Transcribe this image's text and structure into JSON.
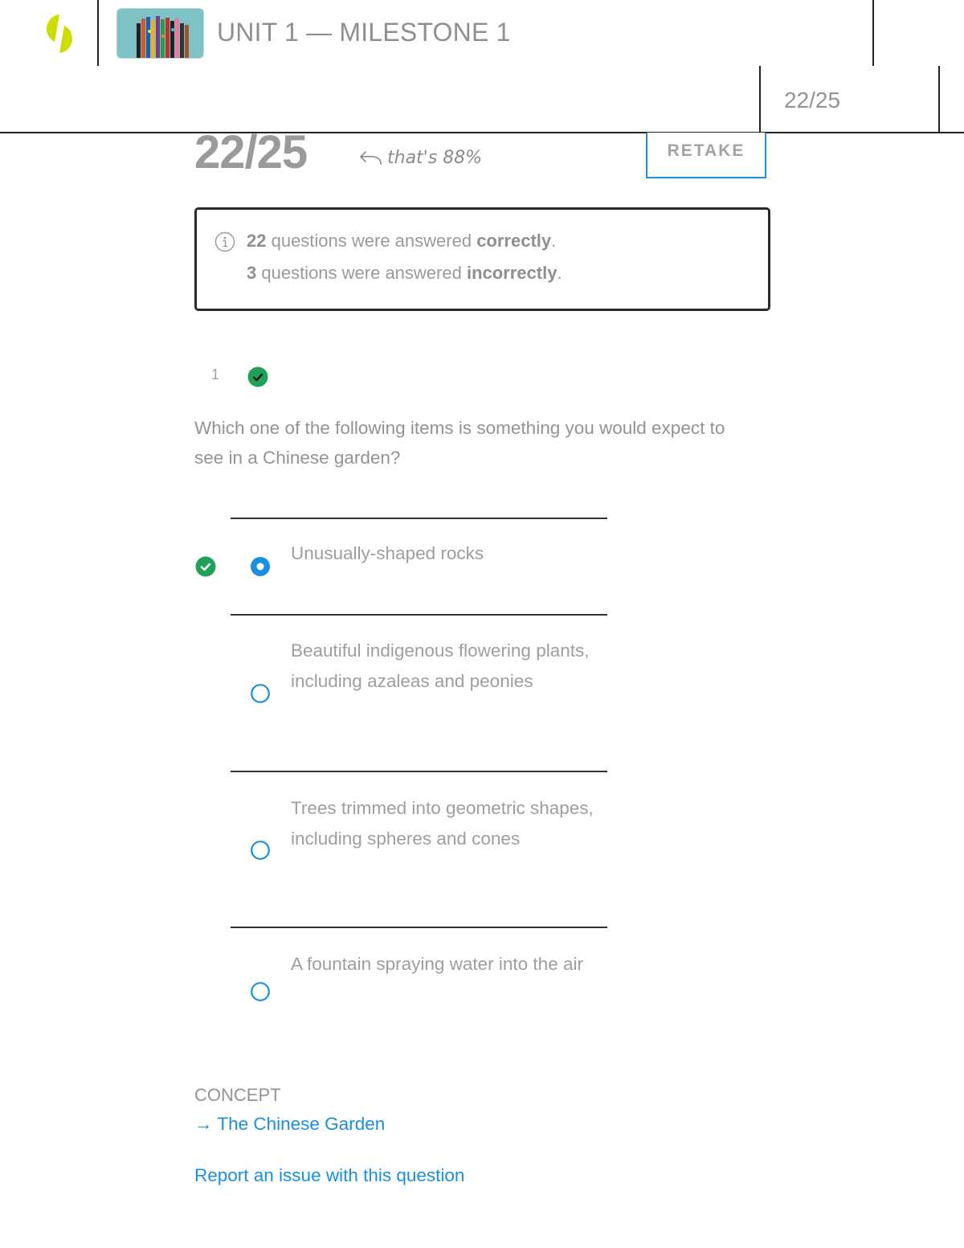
{
  "header": {
    "title": "UNIT 1 — MILESTONE 1",
    "score": "22/25",
    "logo_color": "#cddd00",
    "thumbnail_alt": "paint-brushes-thumbnail"
  },
  "results": {
    "score": "22/25",
    "percent_note": "that's 88%",
    "retake_label": "RETAKE",
    "summary": {
      "correct_count": "22",
      "correct_text": " questions were answered ",
      "correct_word": "correctly",
      "incorrect_count": "3",
      "incorrect_text": " questions were answered ",
      "incorrect_word": "incorrectly",
      "period": "."
    }
  },
  "question": {
    "number": "1",
    "status": "correct",
    "text": "Which one of the following items is something you would expect to see in a Chinese garden?",
    "options": [
      {
        "label": "Unusually-shaped rocks",
        "selected": true,
        "correct": true
      },
      {
        "label": "Beautiful indigenous flowering plants, including azaleas and peonies",
        "selected": false,
        "correct": false
      },
      {
        "label": "Trees trimmed into geometric shapes, including spheres and cones",
        "selected": false,
        "correct": false
      },
      {
        "label": "A fountain spraying water into the air",
        "selected": false,
        "correct": false
      }
    ]
  },
  "concept": {
    "label": "CONCEPT",
    "link_arrow": "→",
    "link_text": "The Chinese Garden"
  },
  "report_link": "Report an issue with this question",
  "colors": {
    "accent_blue": "#1a8fe0",
    "correct_green": "#21a05a",
    "text_gray": "#999999"
  }
}
